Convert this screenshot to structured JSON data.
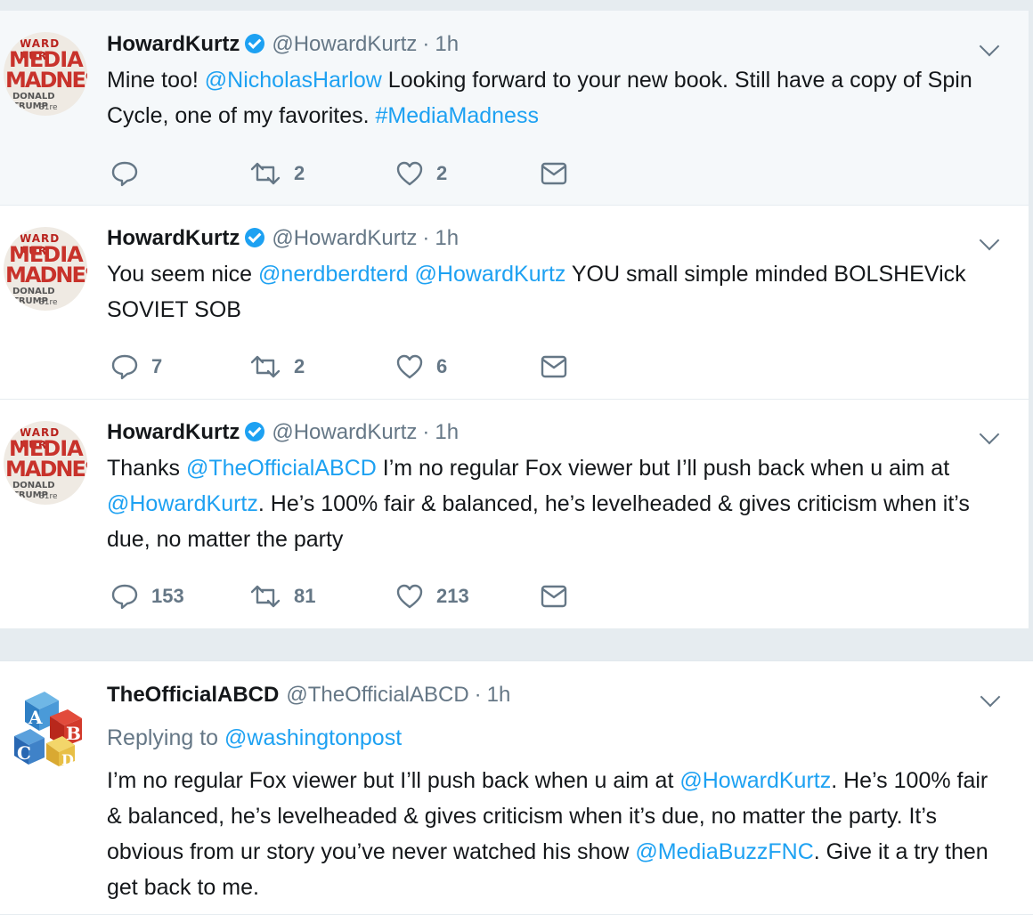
{
  "colors": {
    "link": "#1da1f2",
    "muted": "#657786",
    "text": "#14171a",
    "verified": "#1da1f2"
  },
  "tweets": [
    {
      "name": "HowardKurtz",
      "handle": "@HowardKurtz",
      "dot": "·",
      "time": "1h",
      "segments": [
        {
          "t": "Mine too! ",
          "link": false
        },
        {
          "t": "@NicholasHarlow",
          "link": true
        },
        {
          "t": " Looking forward to your new book. Still have a copy of Spin Cycle, one of my favorites. ",
          "link": false
        },
        {
          "t": "#MediaMadness",
          "link": true
        }
      ],
      "replies": "",
      "retweets": "2",
      "likes": "2"
    },
    {
      "name": "HowardKurtz",
      "handle": "@HowardKurtz",
      "dot": "·",
      "time": "1h",
      "segments": [
        {
          "t": "You seem nice ",
          "link": false
        },
        {
          "t": "@nerdberdterd",
          "link": true
        },
        {
          "t": " ",
          "link": false
        },
        {
          "t": "@HowardKurtz",
          "link": true
        },
        {
          "t": " YOU small simple minded BOLSHEVick SOVIET SOB",
          "link": false
        }
      ],
      "replies": "7",
      "retweets": "2",
      "likes": "6"
    },
    {
      "name": "HowardKurtz",
      "handle": "@HowardKurtz",
      "dot": "·",
      "time": "1h",
      "segments": [
        {
          "t": "Thanks ",
          "link": false
        },
        {
          "t": "@TheOfficialABCD",
          "link": true
        },
        {
          "t": " I’m no regular Fox viewer but I’ll push back when u aim at ",
          "link": false
        },
        {
          "t": "@HowardKurtz",
          "link": true
        },
        {
          "t": ". He’s 100% fair & balanced, he’s levelheaded & gives criticism when it’s due, no matter the party",
          "link": false
        }
      ],
      "replies": "153",
      "retweets": "81",
      "likes": "213"
    },
    {
      "name": "TheOfficialABCD",
      "handle": "@TheOfficialABCD",
      "dot": "·",
      "time": "1h",
      "reply_prefix": "Replying to ",
      "reply_to": "@washingtonpost",
      "segments": [
        {
          "t": "I’m no regular Fox viewer but I’ll push back when u aim at ",
          "link": false
        },
        {
          "t": "@HowardKurtz",
          "link": true
        },
        {
          "t": ". He’s 100% fair & balanced, he’s levelheaded & gives criticism when it’s due, no matter the party. It’s obvious from ur story you’ve never watched his show ",
          "link": false
        },
        {
          "t": "@MediaBuzzFNC",
          "link": true
        },
        {
          "t": ". Give it a try then get back to me.",
          "link": false
        }
      ]
    }
  ],
  "avatar_book": {
    "line_top": "WARD KUR",
    "line1": "MEDIA",
    "line2": "MADNESS",
    "line3": "DONALD TRUMP",
    "line4": "31re"
  },
  "abc_avatar": {
    "a": "A",
    "b": "B",
    "c": "C",
    "d": "D"
  }
}
